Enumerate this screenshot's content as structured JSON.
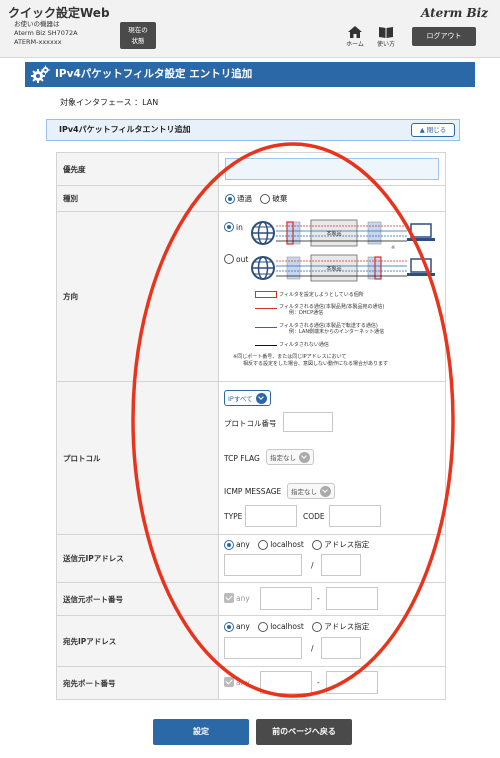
{
  "header": {
    "app_title": "クイック設定Web",
    "device_line1": "お使いの機器は",
    "device_line2": "Aterm Biz SH7072A",
    "device_line3": "ATERM-xxxxxx",
    "status_line1": "現在の",
    "status_line2": "状態",
    "home_label": "ホーム",
    "howto_label": "使い方",
    "brand": "Aterm Biz",
    "logout": "ログアウト"
  },
  "page": {
    "title": "IPv4パケットフィルタ設定 エントリ追加",
    "target_interface": "対象インタフェース ：LAN",
    "section_title": "IPv4パケットフィルタエントリ追加",
    "close_label": "閉じる"
  },
  "form": {
    "priority": {
      "label": "優先度",
      "value": ""
    },
    "type": {
      "label": "種別",
      "options": [
        "通過",
        "破棄"
      ],
      "selected": "通過"
    },
    "direction": {
      "label": "方向",
      "options": [
        "in",
        "out"
      ],
      "selected": "in",
      "product_label": "本製品",
      "legend": [
        {
          "text": "フィルタを設定しようとしている個所"
        },
        {
          "text": "フィルタされる通信(本製品発/本製品宛の通信)",
          "sub": "例：DHCP通信"
        },
        {
          "text": "フィルタされる通信(本製品で転送する通信)",
          "sub": "例：LAN側端末からのインターネット通信"
        },
        {
          "text": "フィルタされない通信"
        }
      ],
      "note_line1": "※同じポート番号、または同じIPアドレスにおいて",
      "note_line2": "相反する設定をした場合、意図しない動作になる場合があります",
      "colors": {
        "filter_box": "#d8312c",
        "red_line": "#d8312c",
        "blue_line": "#2a68a8",
        "black_line": "#111111"
      }
    },
    "protocol": {
      "label": "プロトコル",
      "select_value": "IPすべて",
      "number_label": "プロトコル番号",
      "tcp_flag_label": "TCP FLAG",
      "tcp_flag_value": "指定なし",
      "icmp_label": "ICMP MESSAGE",
      "icmp_value": "指定なし",
      "type_label": "TYPE",
      "code_label": "CODE"
    },
    "src_ip": {
      "label": "送信元IPアドレス",
      "options": [
        "any",
        "localhost",
        "アドレス指定"
      ],
      "selected": "any",
      "separator": "/"
    },
    "src_port": {
      "label": "送信元ポート番号",
      "any_label": "any",
      "separator": "-"
    },
    "dst_ip": {
      "label": "宛先IPアドレス",
      "options": [
        "any",
        "localhost",
        "アドレス指定"
      ],
      "selected": "any",
      "separator": "/"
    },
    "dst_port": {
      "label": "宛先ポート番号",
      "any_label": "any",
      "separator": "-"
    }
  },
  "buttons": {
    "set": "設定",
    "back": "前のページへ戻る"
  },
  "colors": {
    "primary": "#2a68a8",
    "annotation": "#e8341c"
  }
}
